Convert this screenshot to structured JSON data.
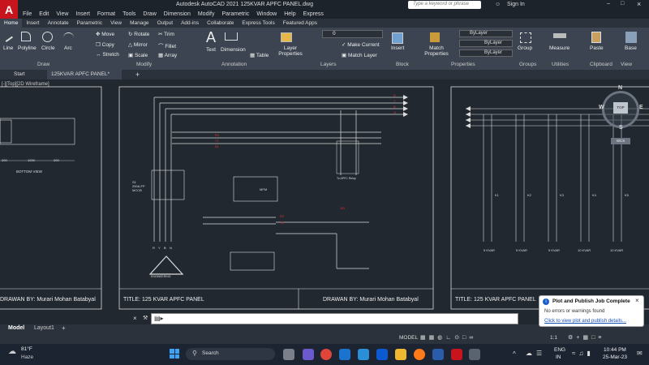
{
  "app": {
    "title": "Autodesk AutoCAD 2021   125KVAR APFC PANEL.dwg",
    "search_placeholder": "Type a keyword or phrase",
    "user": "Sign In"
  },
  "menu": [
    "File",
    "Edit",
    "View",
    "Insert",
    "Format",
    "Tools",
    "Draw",
    "Dimension",
    "Modify",
    "Parametric",
    "Window",
    "Help",
    "Express"
  ],
  "ribbon_tabs": [
    "Home",
    "Insert",
    "Annotate",
    "Parametric",
    "View",
    "Manage",
    "Output",
    "Add-ins",
    "Collaborate",
    "Express Tools",
    "Featured Apps"
  ],
  "ribbon": {
    "draw": {
      "label": "Draw",
      "tools": [
        "Line",
        "Polyline",
        "Circle",
        "Arc"
      ]
    },
    "modify": {
      "label": "Modify",
      "tools": [
        "Move",
        "Rotate",
        "Trim",
        "Copy",
        "Mirror",
        "Fillet",
        "Stretch",
        "Scale",
        "Array"
      ]
    },
    "annotation": {
      "label": "Annotation",
      "tools": [
        "Text",
        "Dimension",
        "Table"
      ]
    },
    "layers": {
      "label": "Layers",
      "layer_value": "0",
      "tools": [
        "Layer Properties",
        "Make Current",
        "Match Layer"
      ]
    },
    "block": {
      "label": "Block",
      "tools": [
        "Insert"
      ]
    },
    "properties": {
      "label": "Properties",
      "tools": [
        "Match Properties"
      ],
      "bylayer": [
        "ByLayer",
        "ByLayer",
        "ByLayer"
      ]
    },
    "groups": {
      "label": "Groups",
      "tools": [
        "Group"
      ]
    },
    "utilities": {
      "label": "Utilities",
      "tools": [
        "Measure"
      ]
    },
    "clipboard": {
      "label": "Clipboard",
      "tools": [
        "Paste"
      ]
    },
    "view": {
      "label": "View",
      "tools": [
        "Base"
      ]
    }
  },
  "file_tabs": [
    "Start",
    "125KVAR APFC PANEL*"
  ],
  "viewport_label": "[-][Top][2D Wireframe]",
  "viewcube": {
    "north": "N",
    "south": "S",
    "west": "W",
    "east": "E",
    "top": "TOP",
    "wcs": "WCS"
  },
  "drawing": {
    "left_sheet": {
      "drawn_by": "DRAWAN BY: Murari Mohan Batabyal",
      "bottom_view": "BOTTOM VIEW",
      "dims": [
        "200",
        "1200",
        "200"
      ]
    },
    "center_sheet": {
      "title": "TITLE: 125 KVAR APFC PANEL",
      "drawn_by": "DRAWAN BY: Murari Mohan Batabyal",
      "mccb": "S1\n250A,FP\nMCCB",
      "relay": "To APFC Relay",
      "phases": [
        "R",
        "Y",
        "B",
        "N"
      ],
      "logo_text": "ENGINEERING",
      "mfm": "MFM"
    },
    "right_sheet": {
      "title": "TITLE: 125 KVAR APFC PANEL",
      "kvar_labels": [
        "5 KVAR",
        "5 KVAR",
        "5 KVAR",
        "10 KVAR",
        "10 KVAR"
      ],
      "contactors": [
        "K1",
        "K2",
        "K3",
        "K4",
        "K5"
      ]
    }
  },
  "command_line": "",
  "layout_tabs": [
    "Model",
    "Layout1"
  ],
  "status": {
    "model": "MODEL",
    "scale": "1:1"
  },
  "toast": {
    "title": "Plot and Publish Job Complete",
    "message": "No errors or warnings found",
    "link": "Click to view plot and publish details..."
  },
  "taskbar": {
    "weather_temp": "81°F",
    "weather_text": "Haze",
    "search": "Search",
    "lang": "ENG",
    "lang2": "IN",
    "time": "10:44 PM",
    "date": "25-Mar-23"
  }
}
